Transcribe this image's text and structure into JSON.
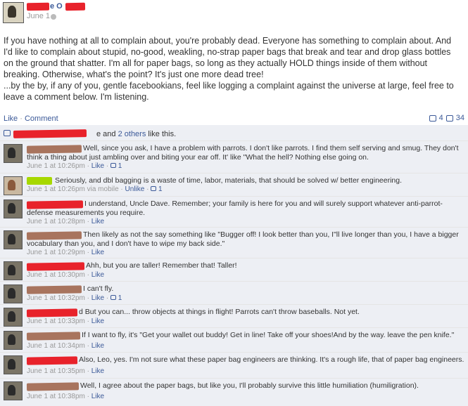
{
  "post": {
    "name_tail": "e O",
    "date": "June 1",
    "body": [
      "If you have nothing at all to complain about, you're probably dead. Everyone has something to complain about. And I'd like to complain about stupid, no-good, weakling, no-strap paper bags that break and tear and drop glass bottles on the ground that shatter. I'm all for paper bags, so long as they actually HOLD things inside of them without breaking. Otherwise, what's the point? It's just one more dead tree!",
      "...by the by, if any of you, gentle facebookians, feel like logging a complaint against the universe at large, feel free to leave a comment below. I'm listening."
    ],
    "like_label": "Like",
    "separator": "·",
    "comment_label": "Comment",
    "likes_count": "4",
    "comments_count": "34"
  },
  "likes_row": {
    "tail": "e and",
    "others": "2 others",
    "suffix": "like this."
  },
  "comments": [
    {
      "text": "Well, since you ask, I have a problem with parrots. I don't like parrots. I find them self serving and smug. They don't think a thing about just ambling over and biting your ear off. It' like \"What the hell? Nothing else going on.",
      "time": "June 1 at 10:26pm",
      "via": "",
      "action": "Like",
      "likes": "1"
    },
    {
      "text": "Seriously, and dbl bagging is a waste of time, labor, materials, that should be solved w/ better engineering.",
      "time": "June 1 at 10:26pm",
      "via": "via mobile",
      "action": "Unlike",
      "likes": "1"
    },
    {
      "text": "I understand, Uncle Dave. Remember; your family is here for you and will surely support whatever anti-parrot-defense measurements you require.",
      "time": "June 1 at 10:28pm",
      "via": "",
      "action": "Like",
      "likes": ""
    },
    {
      "text": "Then likely as not the say something like \"Bugger off! I look better than you, I\"ll live longer than you, I have a bigger vocabulary than you, and I don't have to wipe my back side.\"",
      "time": "June 1 at 10:29pm",
      "via": "",
      "action": "Like",
      "likes": ""
    },
    {
      "text": "Ahh, but you are taller! Remember that! Taller!",
      "time": "June 1 at 10:30pm",
      "via": "",
      "action": "Like",
      "likes": ""
    },
    {
      "text": "I can't fly.",
      "time": "June 1 at 10:32pm",
      "via": "",
      "action": "Like",
      "likes": "1"
    },
    {
      "text": "d But you can... throw objects at things in flight! Parrots can't throw baseballs. Not yet.",
      "time": "June 1 at 10:33pm",
      "via": "",
      "action": "Like",
      "likes": ""
    },
    {
      "text": "If I want to fly, it's \"Get your wallet out buddy! Get in line! Take off your shoes!And by the way. leave the pen knife.\"",
      "time": "June 1 at 10:34pm",
      "via": "",
      "action": "Like",
      "likes": ""
    },
    {
      "text": "Also, Leo, yes. I'm not sure what these paper bag engineers are thinking. It's a rough life, that of paper bag engineers.",
      "time": "June 1 at 10:35pm",
      "via": "",
      "action": "Like",
      "likes": ""
    },
    {
      "text": "Well, I agree about the paper bags, but like you, I'll probably survive this little humiliation (humiligration).",
      "time": "June 1 at 10:38pm",
      "via": "",
      "action": "Like",
      "likes": ""
    }
  ],
  "colors": {
    "link": "#3b5998",
    "feedback_bg": "#edeff4",
    "redaction_red": "#e8222b",
    "redaction_brown": "#a8745e",
    "redaction_green": "#a7d800"
  },
  "icons": {
    "like": "thumbs-up-icon",
    "comment": "speech-bubble-icon",
    "audience": "friends-icon"
  }
}
